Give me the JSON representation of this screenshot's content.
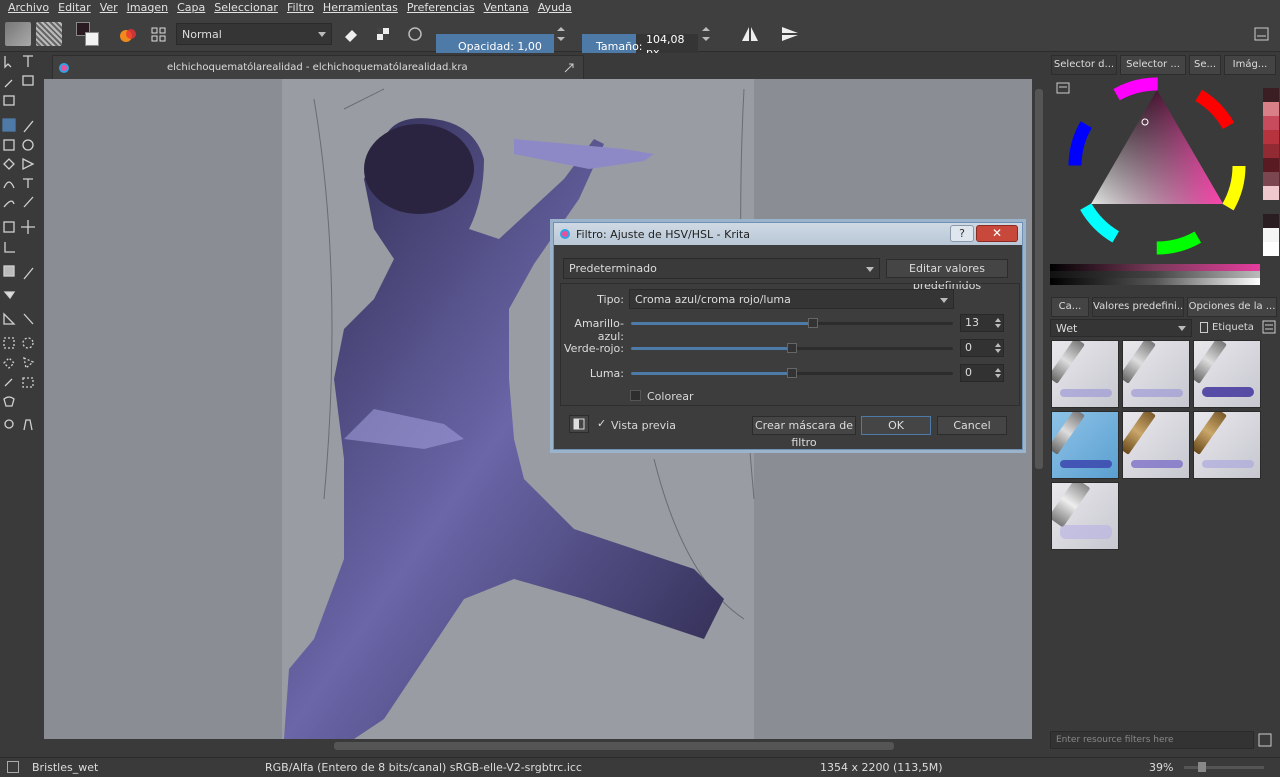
{
  "menubar": {
    "items": [
      "Archivo",
      "Editar",
      "Ver",
      "Imagen",
      "Capa",
      "Seleccionar",
      "Filtro",
      "Herramientas",
      "Preferencias",
      "Ventana",
      "Ayuda"
    ]
  },
  "toolbar": {
    "blend_mode": "Normal",
    "opacity_label": "Opacidad:",
    "opacity_value": "1,00",
    "size_label": "Tamaño:",
    "size_value": "104,08 px"
  },
  "document": {
    "tab_title": "elchichoquematólarealidad - elchichoquematólarealidad.kra"
  },
  "dialog": {
    "title": "Filtro: Ajuste de HSV/HSL - Krita",
    "preset": "Predeterminado",
    "edit_presets": "Editar valores predefinidos",
    "type_label": "Tipo:",
    "type_value": "Croma azul/croma rojo/luma",
    "sliders": [
      {
        "label": "Amarillo-azul:",
        "value": "13",
        "fraction": 0.565
      },
      {
        "label": "Verde-rojo:",
        "value": "0",
        "fraction": 0.5
      },
      {
        "label": "Luma:",
        "value": "0",
        "fraction": 0.5
      }
    ],
    "colorize_label": "Colorear",
    "preview_label": "Vista previa",
    "create_mask": "Crear máscara de filtro",
    "ok": "OK",
    "cancel": "Cancel"
  },
  "dock": {
    "top_tabs": [
      "Selector d...",
      "Selector ...",
      "Se...",
      "Imág..."
    ],
    "bottom_tabs": [
      "Ca...",
      "Valores predefini...",
      "Opciones de la ..."
    ],
    "tag_filter": "Wet",
    "tag_label": "Etiqueta",
    "resource_filter_placeholder": "Enter resource filters here"
  },
  "status": {
    "brush_name": "Bristles_wet",
    "color_profile": "RGB/Alfa (Entero de 8 bits/canal)  sRGB-elle-V2-srgbtrc.icc",
    "dimensions": "1354 x 2200 (113,5M)",
    "zoom": "39%"
  },
  "colors": {
    "accent": "#4e7aa8",
    "canvas_bg": "#8b8d94",
    "figure": "#3a3560"
  }
}
